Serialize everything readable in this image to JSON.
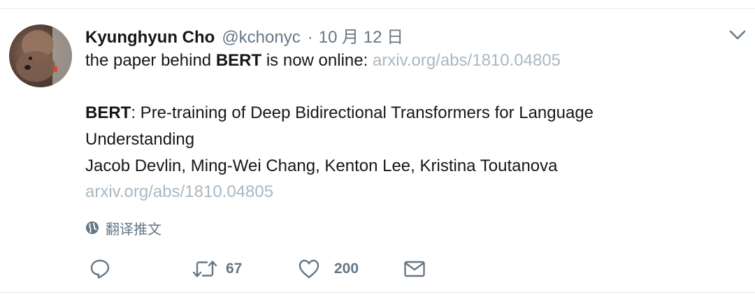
{
  "tweet": {
    "author_name": "Kyunghyun Cho",
    "author_handle": "@kchonyc",
    "separator": "·",
    "date": "10 月 12 日",
    "text_prefix": "the paper behind ",
    "text_bold": "BERT",
    "text_suffix": " is now online: ",
    "text_link": "arxiv.org/abs/1810.04805",
    "paper_title_bold": "BERT",
    "paper_title_rest": ": Pre-training of Deep Bidirectional Transformers for Language",
    "paper_title_line2": "Understanding",
    "paper_authors": "Jacob Devlin, Ming-Wei Chang, Kenton Lee, Kristina Toutanova",
    "paper_link": "arxiv.org/abs/1810.04805",
    "translate_label": "翻译推文"
  },
  "actions": {
    "reply_icon": "reply-icon",
    "retweet_icon": "retweet-icon",
    "retweet_count": "67",
    "like_icon": "heart-icon",
    "like_count": "200",
    "dm_icon": "envelope-icon"
  },
  "colors": {
    "text": "#14171a",
    "secondary": "#657786",
    "link": "#aab8c2",
    "divider": "#e6ecf0"
  }
}
